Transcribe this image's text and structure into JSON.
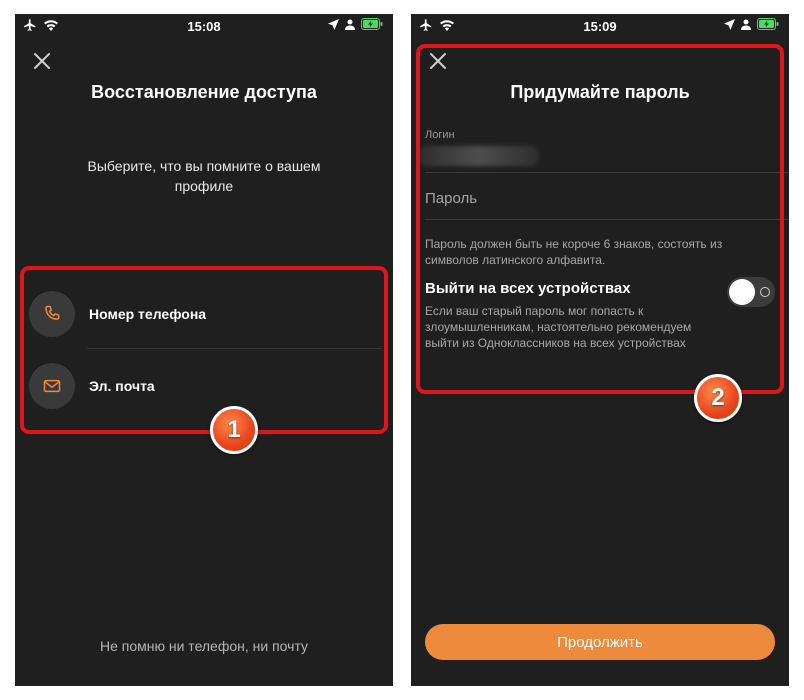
{
  "screen1": {
    "status": {
      "time": "15:08"
    },
    "title": "Восстановление доступа",
    "subtitle": "Выберите, что вы помните о вашем профиле",
    "options": [
      {
        "label": "Номер телефона",
        "icon": "phone-icon"
      },
      {
        "label": "Эл. почта",
        "icon": "mail-icon"
      }
    ],
    "bottom_link": "Не помню ни телефон, ни почту",
    "badge": "1"
  },
  "screen2": {
    "status": {
      "time": "15:09"
    },
    "title": "Придумайте пароль",
    "login_label": "Логин",
    "password_placeholder": "Пароль",
    "password_hint": "Пароль должен быть не короче 6 знаков, состоять из символов латинского алфавита.",
    "logout_title": "Выйти на всех устройствах",
    "logout_desc": "Если ваш старый пароль мог попасть к злоумышленникам, настоятельно рекомендуем выйти из Одноклассников на всех устройствах",
    "toggle_on": false,
    "continue_label": "Продолжить",
    "badge": "2"
  },
  "colors": {
    "background": "#1f1f1f",
    "accent_orange": "#ed8a3b",
    "highlight_red": "#e0141b",
    "battery_green": "#4cd964"
  }
}
